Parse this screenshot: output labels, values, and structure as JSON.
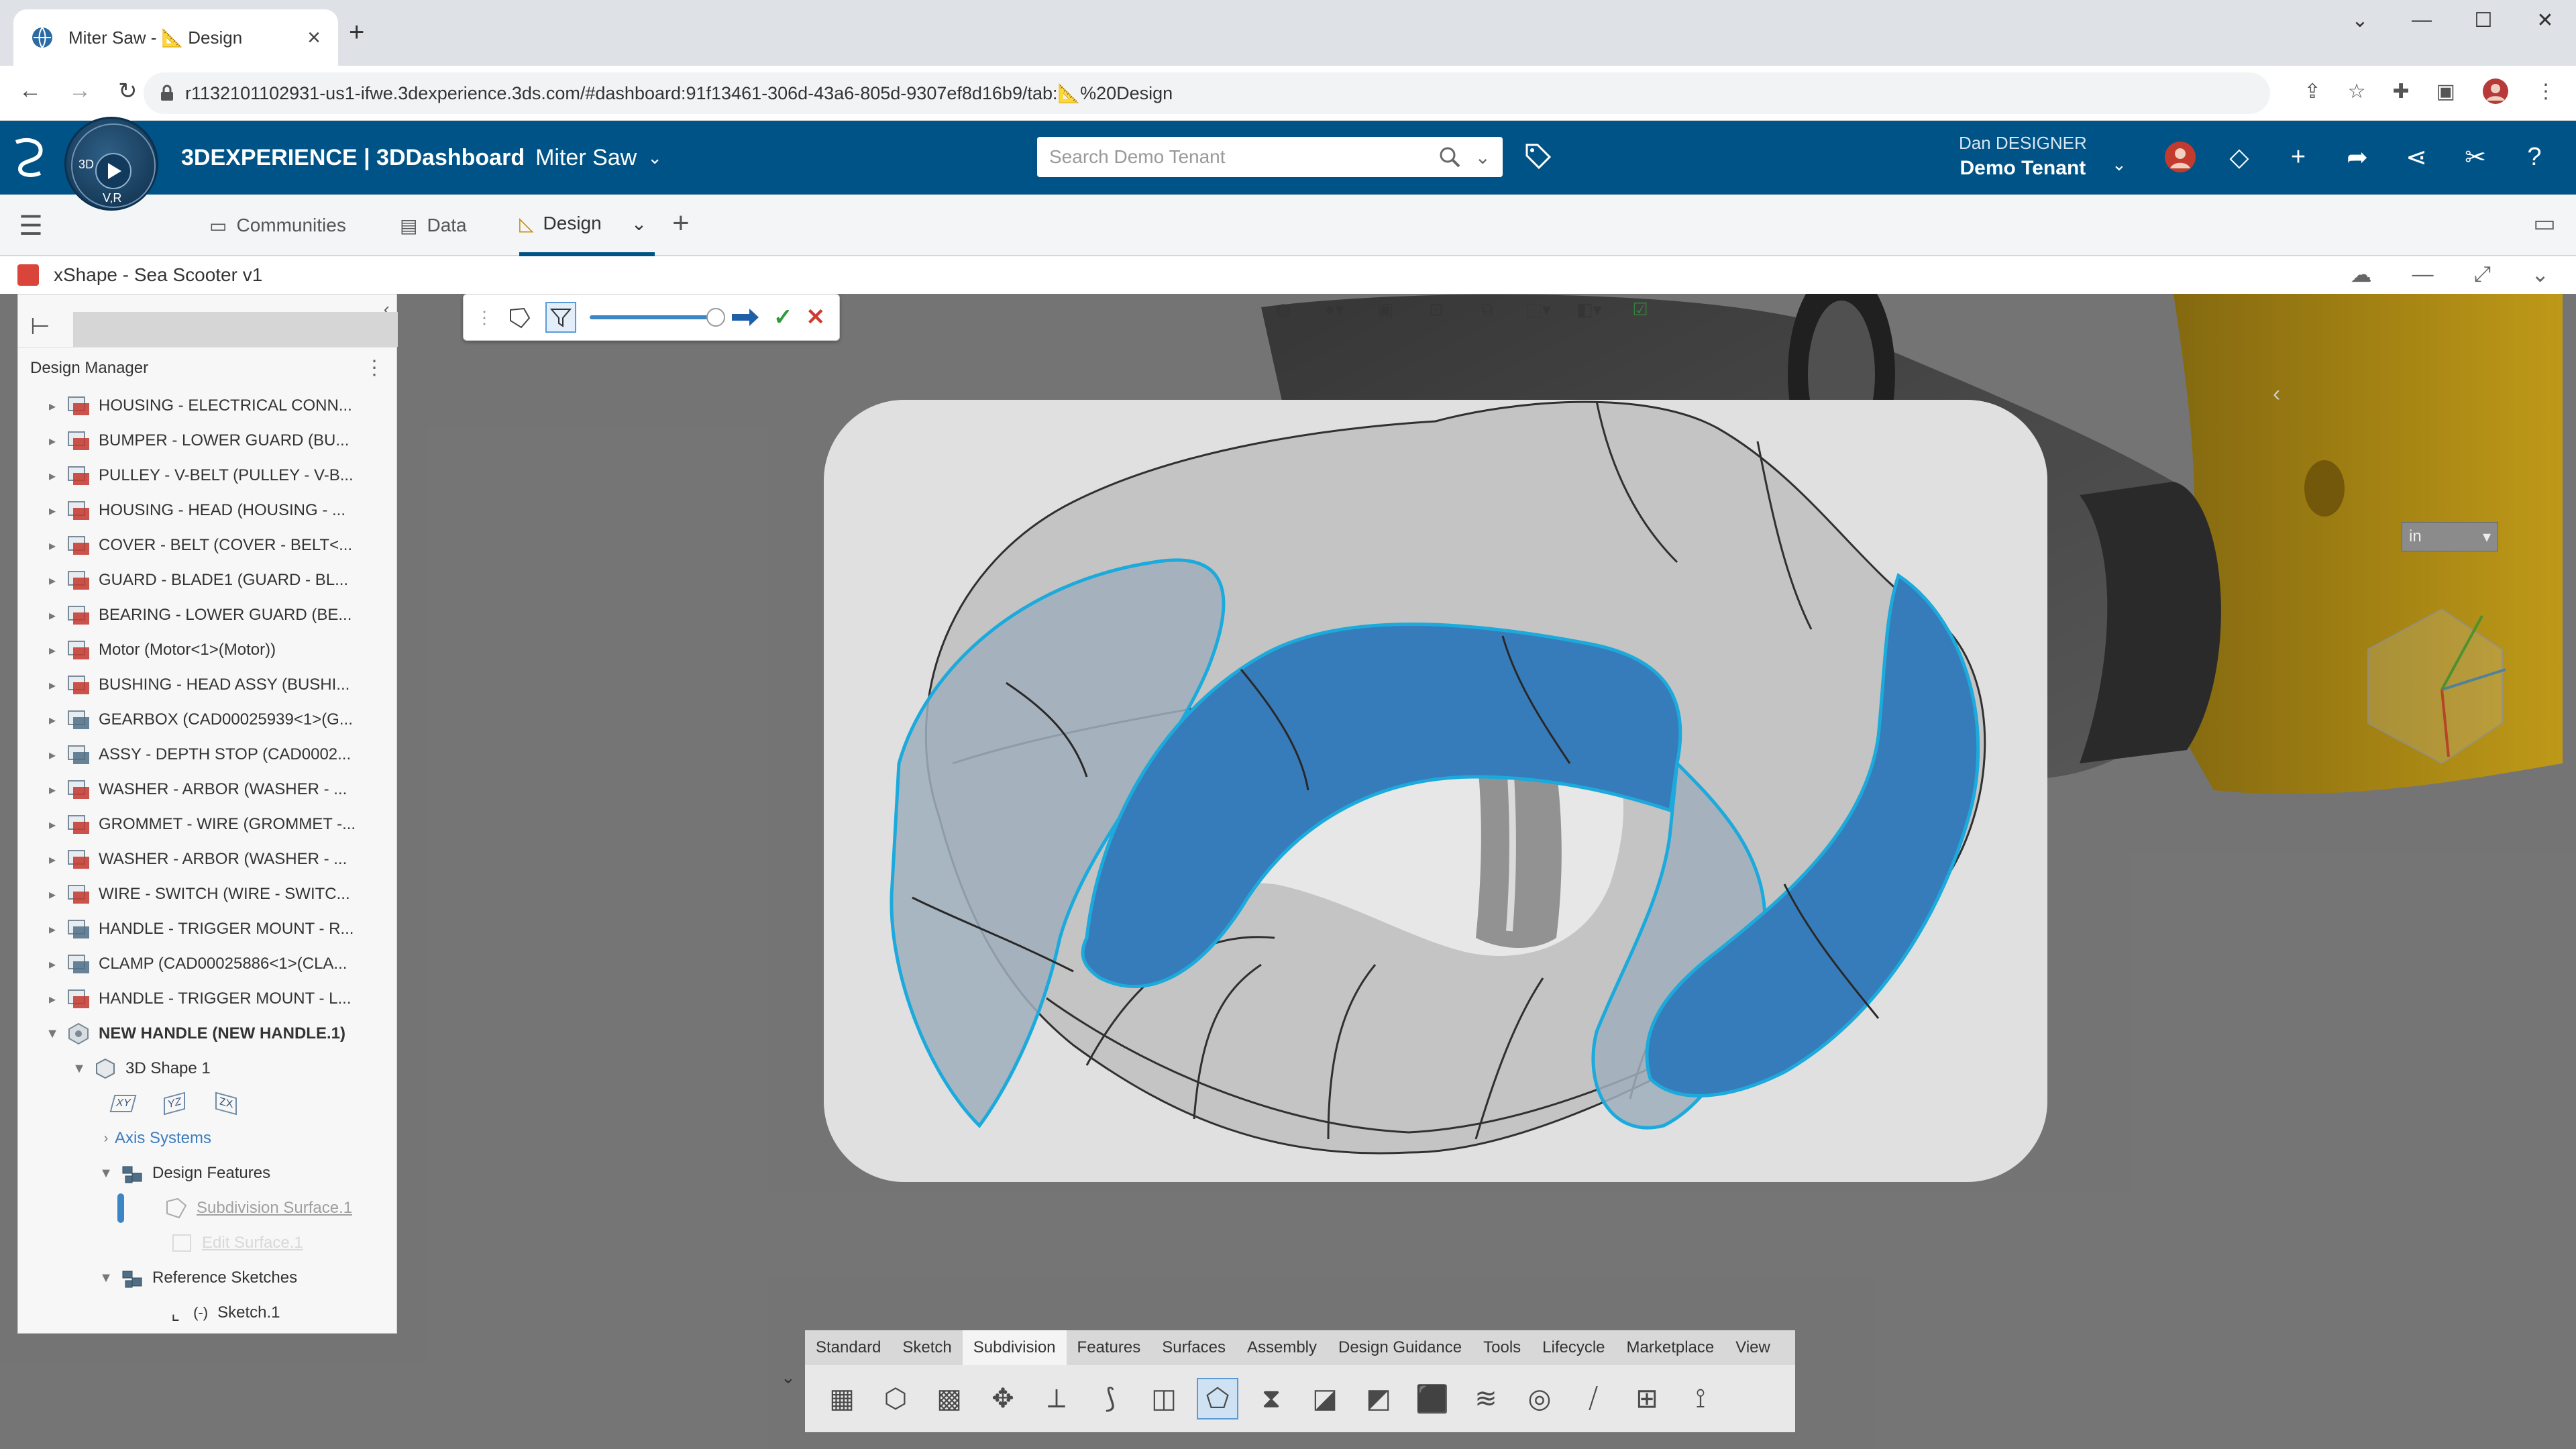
{
  "browser": {
    "tab_title": "Miter Saw - 📐 Design",
    "url": "r1132101102931-us1-ifwe.3dexperience.3ds.com/#dashboard:91f13461-306d-43a6-805d-9307ef8d16b9/tab:📐%20Design"
  },
  "header": {
    "brand": "3DEXPERIENCE | 3DDashboard",
    "dashboard": "Miter Saw",
    "compass_top": "3D",
    "compass_bottom": "V,R",
    "search_placeholder": "Search Demo Tenant",
    "user_name": "Dan DESIGNER",
    "tenant": "Demo Tenant"
  },
  "dashboard_tabs": [
    {
      "label": "Communities",
      "icon": "communities-icon"
    },
    {
      "label": "Data",
      "icon": "data-icon"
    },
    {
      "label": "Design",
      "icon": "design-icon",
      "active": true
    }
  ],
  "widget": {
    "title": "xShape - Sea Scooter v1"
  },
  "design_manager": {
    "title": "Design Manager",
    "items": [
      "HOUSING - ELECTRICAL CONN...",
      "BUMPER - LOWER GUARD (BU...",
      "PULLEY - V-BELT (PULLEY - V-B...",
      "HOUSING - HEAD (HOUSING - ...",
      "COVER - BELT (COVER - BELT<...",
      "GUARD - BLADE1 (GUARD - BL...",
      "BEARING - LOWER GUARD (BE...",
      "Motor (Motor<1>(Motor))",
      "BUSHING - HEAD ASSY (BUSHI...",
      "GEARBOX (CAD00025939<1>(G...",
      "ASSY - DEPTH STOP (CAD0002...",
      "WASHER - ARBOR (WASHER - ...",
      "GROMMET - WIRE (GROMMET -...",
      "WASHER - ARBOR (WASHER - ...",
      "WIRE - SWITCH (WIRE - SWITC...",
      "HANDLE - TRIGGER MOUNT - R...",
      "CLAMP (CAD00025886<1>(CLA...",
      "HANDLE - TRIGGER MOUNT - L..."
    ],
    "new_handle": "NEW HANDLE (NEW HANDLE.1)",
    "shape": "3D Shape 1",
    "planes": [
      "XY",
      "YZ",
      "ZX"
    ],
    "axis_systems": "Axis Systems",
    "design_features": "Design Features",
    "subdivision_surface": "Subdivision Surface.1",
    "hidden_feature": "Edit Surface.1",
    "reference_sketches": "Reference Sketches",
    "sketch": "Sketch.1"
  },
  "viewer": {
    "units": "in"
  },
  "action_bar": {
    "tabs": [
      "Standard",
      "Sketch",
      "Subdivision",
      "Features",
      "Surfaces",
      "Assembly",
      "Design Guidance",
      "Tools",
      "Lifecycle",
      "Marketplace",
      "View"
    ],
    "active_tab": "Subdivision"
  },
  "colors": {
    "accent": "#005386",
    "selection": "#1eb4e8",
    "face_blue": "#3a83c4",
    "yellow_part": "#c9a21a"
  }
}
